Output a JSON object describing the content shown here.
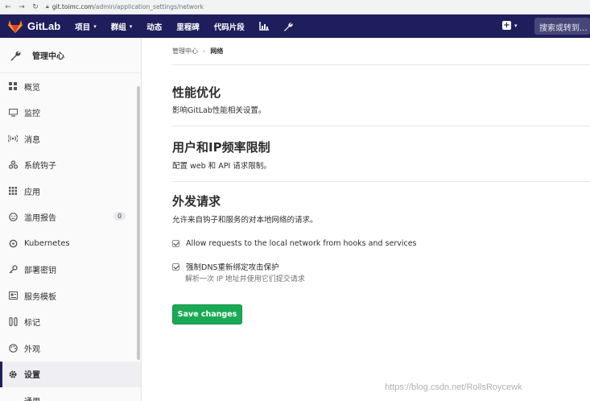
{
  "browser": {
    "url_host": "git.toimc.com",
    "url_path": "/admin/application_settings/network"
  },
  "topnav": {
    "brand": "GitLab",
    "items": [
      "项目",
      "群组",
      "动态",
      "里程碑",
      "代码片段"
    ],
    "search_placeholder": "搜索或转到..."
  },
  "sidebar": {
    "title": "管理中心",
    "items": [
      {
        "label": "概览",
        "icon": "overview-icon"
      },
      {
        "label": "监控",
        "icon": "monitor-icon"
      },
      {
        "label": "消息",
        "icon": "broadcast-icon"
      },
      {
        "label": "系统钩子",
        "icon": "hook-icon"
      },
      {
        "label": "应用",
        "icon": "apps-icon"
      },
      {
        "label": "滥用报告",
        "icon": "abuse-icon",
        "badge": "0"
      },
      {
        "label": "Kubernetes",
        "icon": "kubernetes-icon"
      },
      {
        "label": "部署密钥",
        "icon": "key-icon"
      },
      {
        "label": "服务模板",
        "icon": "template-icon"
      },
      {
        "label": "标记",
        "icon": "label-icon"
      },
      {
        "label": "外观",
        "icon": "appearance-icon"
      },
      {
        "label": "设置",
        "icon": "settings-icon",
        "active": true
      },
      {
        "label": "通用",
        "icon": ""
      }
    ]
  },
  "breadcrumb": {
    "parent": "管理中心",
    "current": "网络"
  },
  "sections": {
    "performance": {
      "title": "性能优化",
      "desc": "影响GitLab性能相关设置。"
    },
    "rate_limit": {
      "title": "用户和IP频率限制",
      "desc": "配置 web 和 API 请求限制。"
    },
    "outbound": {
      "title": "外发请求",
      "desc": "允许来自钩子和服务的对本地网络的请求。"
    }
  },
  "options": {
    "allow_local": {
      "label": "Allow requests to the local network from hooks and services",
      "checked": true
    },
    "dns_rebind": {
      "label": "强制DNS重新绑定攻击保护",
      "help": "解析一次 IP 地址并使用它们提交请求",
      "checked": true
    }
  },
  "save_button": "Save changes",
  "watermark": "https://blog.csdn.net/RollsRoycewk",
  "colors": {
    "nav_bg": "#1f1e5c",
    "save_green": "#1aaa55"
  }
}
